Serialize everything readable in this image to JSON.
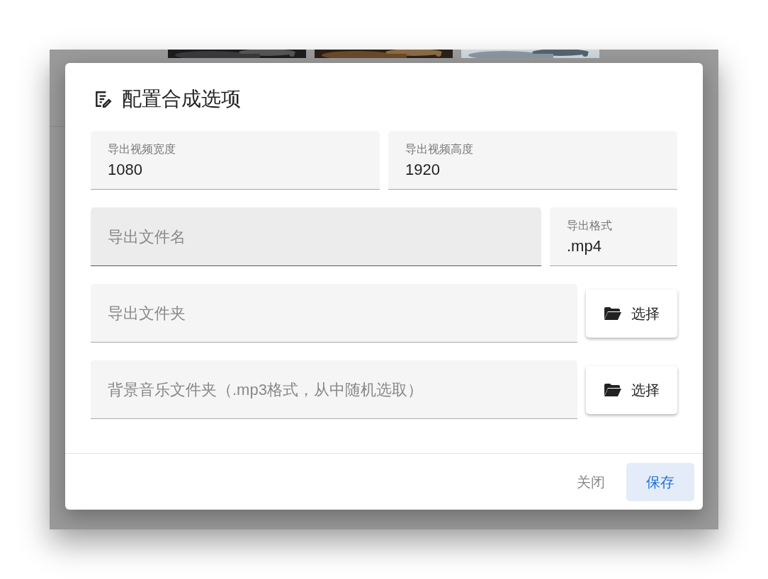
{
  "dialog": {
    "title": "配置合成选项",
    "rows": [
      [
        {
          "kind": "field",
          "label": "导出视频宽度",
          "value": "1080",
          "active": false
        },
        {
          "kind": "field",
          "label": "导出视频高度",
          "value": "1920",
          "active": false
        }
      ],
      [
        {
          "kind": "field",
          "placeholder": "导出文件名",
          "active": true
        },
        {
          "kind": "field",
          "label": "导出格式",
          "value": ".mp4",
          "active": false
        }
      ],
      [
        {
          "kind": "field",
          "placeholder": "导出文件夹",
          "active": false
        },
        {
          "kind": "button",
          "label": "选择"
        }
      ],
      [
        {
          "kind": "field",
          "placeholder": "背景音乐文件夹（.mp3格式，从中随机选取）",
          "active": false
        },
        {
          "kind": "button",
          "label": "选择"
        }
      ]
    ],
    "actions": [
      {
        "kind": "text",
        "label": "关闭"
      },
      {
        "kind": "primary",
        "label": "保存"
      }
    ]
  }
}
